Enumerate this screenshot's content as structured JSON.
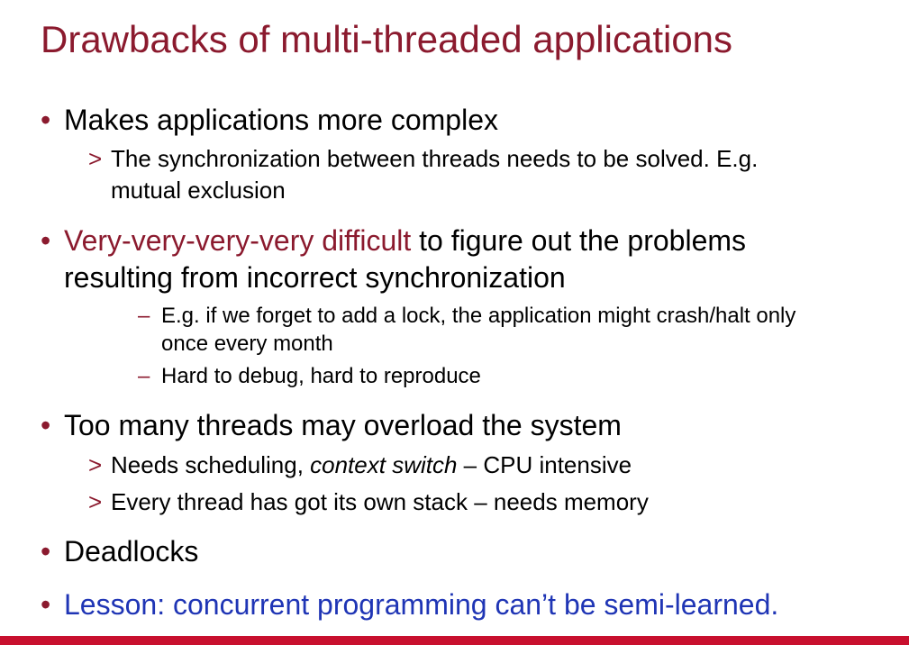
{
  "title": "Drawbacks of multi-threaded applications",
  "bullets": {
    "b1": {
      "marker": "•",
      "text": "Makes applications more complex",
      "sub1": {
        "marker": ">",
        "line1": "The synchronization between threads needs to be solved. E.g.",
        "line2": "mutual exclusion"
      }
    },
    "b2": {
      "marker": "•",
      "highlight": "Very-very-very-very difficult",
      "rest_line1": " to figure out the problems",
      "line2": "resulting from incorrect synchronization",
      "sub1": {
        "marker": "–",
        "line1": "E.g. if we forget to add a lock, the application might crash/halt only",
        "line2": "once every month"
      },
      "sub2": {
        "marker": "–",
        "text": "Hard to debug, hard to reproduce"
      }
    },
    "b3": {
      "marker": "•",
      "text": "Too many threads may overload the system",
      "sub1": {
        "marker": ">",
        "pre": "Needs scheduling, ",
        "italic": "context switch",
        "post": " – CPU intensive"
      },
      "sub2": {
        "marker": ">",
        "text": "Every thread has got its own stack – needs memory"
      }
    },
    "b4": {
      "marker": "•",
      "text": "Deadlocks"
    },
    "b5": {
      "marker": "•",
      "text": "Lesson: concurrent programming can’t be semi-learned."
    }
  },
  "colors": {
    "title": "#8b1a2e",
    "highlight": "#8b1a2e",
    "lesson": "#1f35b5",
    "footer": "#c8102e"
  }
}
